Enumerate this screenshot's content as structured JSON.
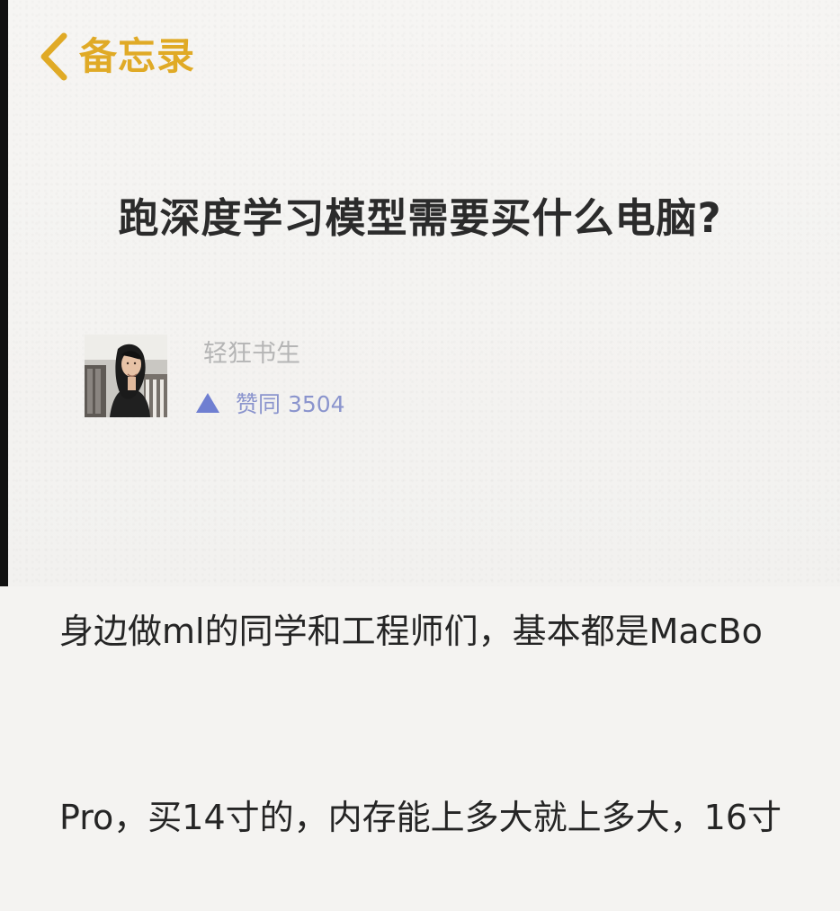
{
  "nav": {
    "back_label": "备忘录"
  },
  "question": {
    "title": "跑深度学习模型需要买什么电脑?"
  },
  "answer": {
    "author": "轻狂书生",
    "vote_label": "赞同 3504",
    "body_lines": [
      "身边做ml的同学和工程师们，基本都是MacBo",
      "Pro，买14寸的，内存能上多大就上多大，16寸"
    ]
  },
  "colors": {
    "accent": "#e0aa26",
    "vote": "#8a94cd",
    "title": "#2b2b2b",
    "muted": "#b5b5b5",
    "background": "#f4f3f1"
  },
  "icons": {
    "back": "chevron-left-icon",
    "vote": "triangle-up-icon",
    "avatar": "user-photo"
  }
}
